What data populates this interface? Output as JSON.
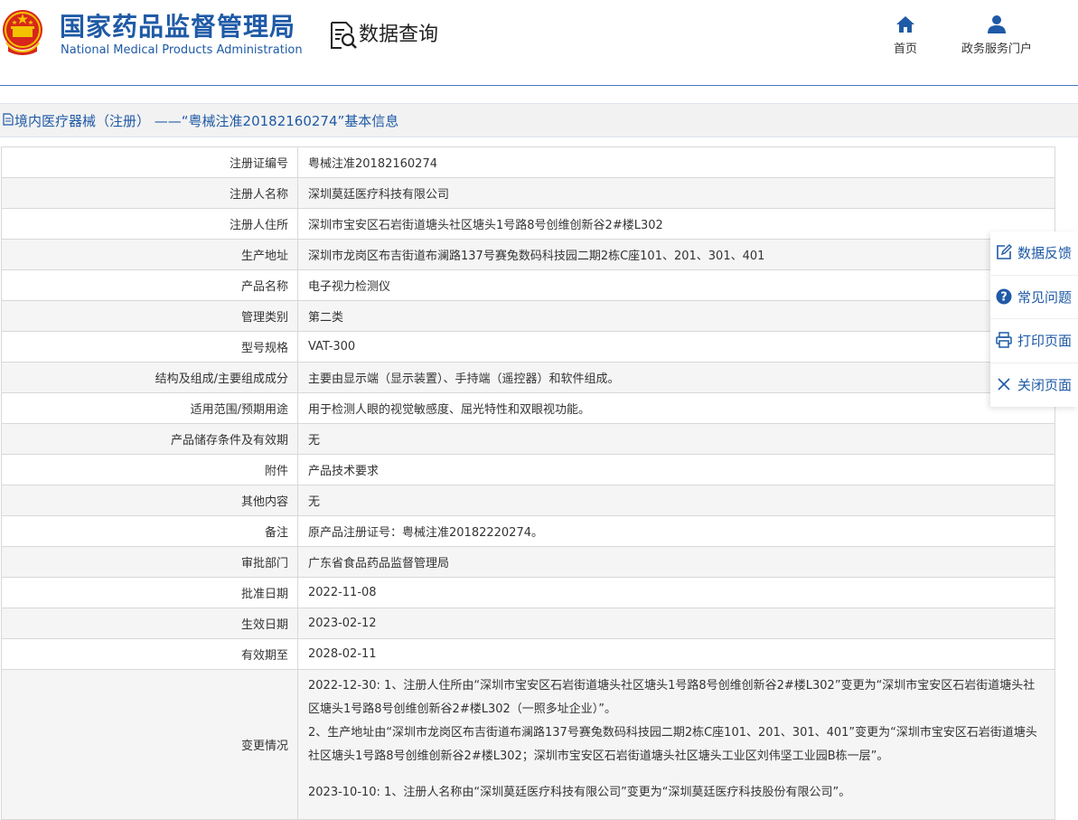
{
  "header": {
    "org_name_cn": "国家药品监督管理局",
    "org_name_en": "National Medical Products Administration",
    "section_title": "数据查询",
    "nav": [
      {
        "label": "首页",
        "icon": "home-icon"
      },
      {
        "label": "政务服务门户",
        "icon": "user-icon"
      }
    ]
  },
  "breadcrumb": {
    "text": "境内医疗器械（注册） ——“粤械注准20182160274”基本信息",
    "icon": "document-icon"
  },
  "record": {
    "rows": [
      {
        "label": "注册证编号",
        "value": "粤械注准20182160274"
      },
      {
        "label": "注册人名称",
        "value": "深圳莫廷医疗科技有限公司"
      },
      {
        "label": "注册人住所",
        "value": "深圳市宝安区石岩街道塘头社区塘头1号路8号创维创新谷2#楼L302"
      },
      {
        "label": "生产地址",
        "value": "深圳市龙岗区布吉街道布澜路137号赛兔数码科技园二期2栋C座101、201、301、401"
      },
      {
        "label": "产品名称",
        "value": "电子视力检测仪"
      },
      {
        "label": "管理类别",
        "value": "第二类"
      },
      {
        "label": "型号规格",
        "value": "VAT-300"
      },
      {
        "label": "结构及组成/主要组成成分",
        "value": "主要由显示端（显示装置）、手持端（遥控器）和软件组成。"
      },
      {
        "label": "适用范围/预期用途",
        "value": "用于检测人眼的视觉敏感度、屈光特性和双眼视功能。"
      },
      {
        "label": "产品储存条件及有效期",
        "value": "无"
      },
      {
        "label": "附件",
        "value": "产品技术要求"
      },
      {
        "label": "其他内容",
        "value": "无"
      },
      {
        "label": "备注",
        "value": "原产品注册证号：粤械注准20182220274。"
      },
      {
        "label": "审批部门",
        "value": "广东省食品药品监督管理局"
      },
      {
        "label": "批准日期",
        "value": "2022-11-08"
      },
      {
        "label": "生效日期",
        "value": "2023-02-12"
      },
      {
        "label": "有效期至",
        "value": "2028-02-11"
      }
    ],
    "changes": {
      "label": "变更情况",
      "line1": "2022-12-30: 1、注册人住所由“深圳市宝安区石岩街道塘头社区塘头1号路8号创维创新谷2#楼L302”变更为“深圳市宝安区石岩街道塘头社区塘头1号路8号创维创新谷2#楼L302（一照多址企业）”。",
      "line2": "2、生产地址由“深圳市龙岗区布吉街道布澜路137号赛兔数码科技园二期2栋C座101、201、301、401”变更为“深圳市宝安区石岩街道塘头社区塘头1号路8号创维创新谷2#楼L302；深圳市宝安区石岩街道塘头社区塘头工业区刘伟坚工业园B栋一层”。",
      "line3": "2023-10-10: 1、注册人名称由“深圳莫廷医疗科技有限公司”变更为“深圳莫廷医疗科技股份有限公司”。"
    }
  },
  "side_panel": [
    {
      "label": "数据反馈",
      "icon": "edit-icon"
    },
    {
      "label": "常见问题",
      "icon": "question-icon"
    },
    {
      "label": "打印页面",
      "icon": "printer-icon"
    },
    {
      "label": "关闭页面",
      "icon": "close-icon"
    }
  ],
  "colors": {
    "brand_blue": "#1f5aa6",
    "emblem_red": "#d7261c",
    "emblem_gold": "#f4c300",
    "row_alt": "#f5f5f5",
    "border": "#d8d8d8"
  }
}
